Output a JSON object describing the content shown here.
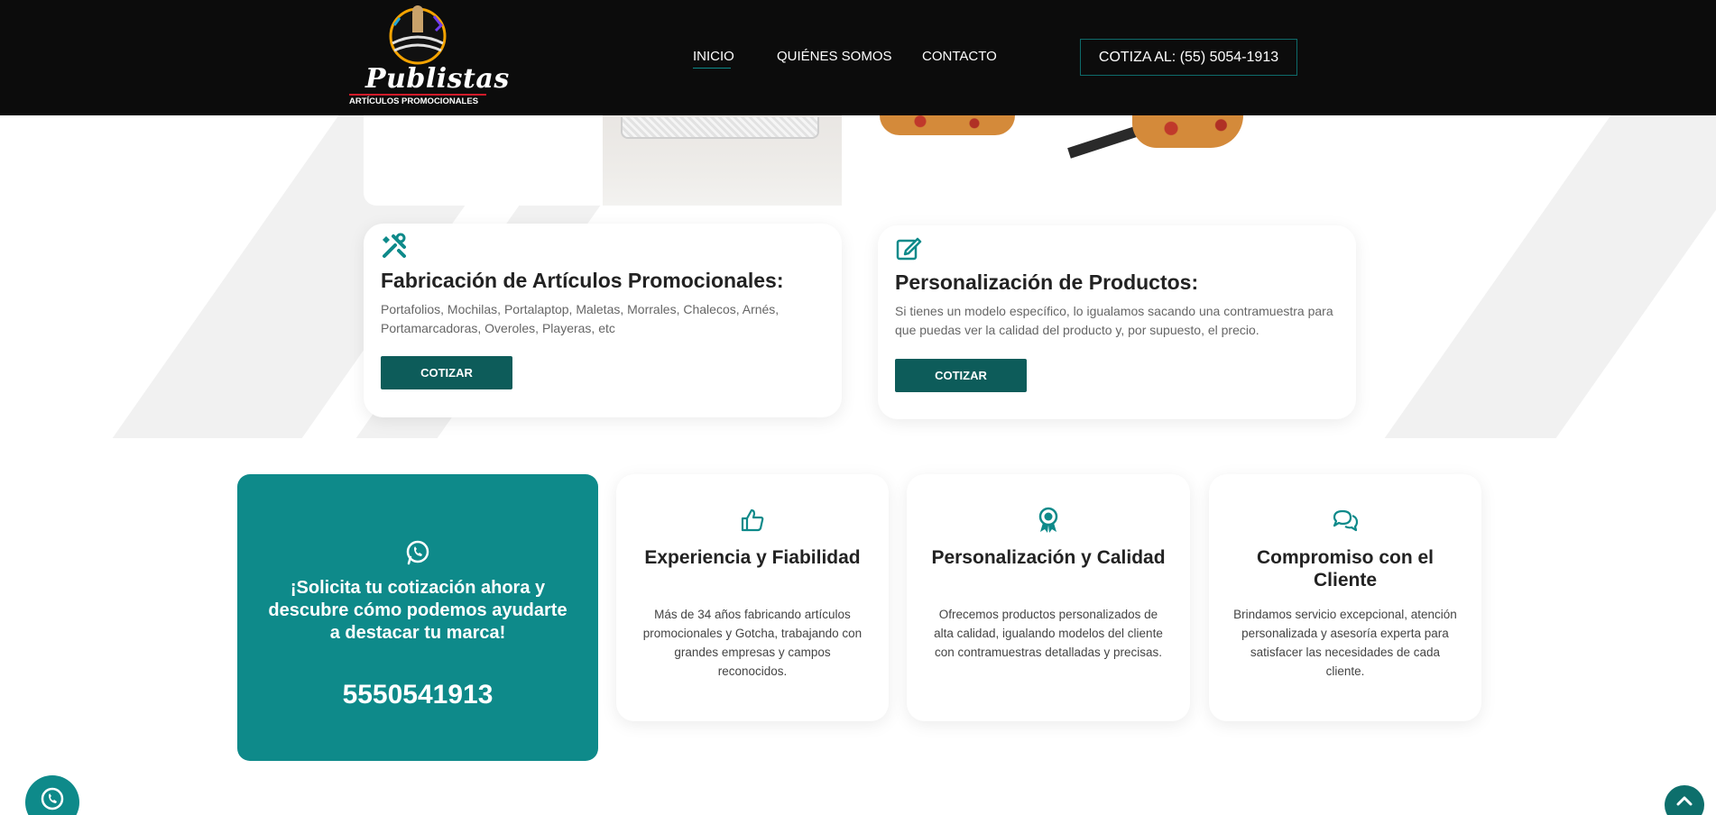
{
  "header": {
    "logo": {
      "brand": "Publistas",
      "tagline": "ARTÍCULOS PROMOCIONALES"
    },
    "nav": [
      {
        "label": "INICIO",
        "active": true
      },
      {
        "label": "QUIÉNES SOMOS",
        "active": false
      },
      {
        "label": "CONTACTO",
        "active": false
      }
    ],
    "cta_label": "COTIZA AL: (55) 5054-1913"
  },
  "services": [
    {
      "icon": "tools-icon",
      "title": "Fabricación de Artículos Promocionales:",
      "text": "Portafolios, Mochilas, Portalaptop, Maletas, Morrales, Chalecos, Arnés, Portamarcadoras, Overoles, Playeras, etc",
      "button": "COTIZAR"
    },
    {
      "icon": "edit-icon",
      "title": "Personalización de Productos:",
      "text": "Si tienes un modelo específico, lo igualamos sacando una contramuestra para que puedas ver la calidad del producto y, por supuesto, el precio.",
      "button": "COTIZAR"
    }
  ],
  "promo": {
    "icon": "whatsapp-icon",
    "text": "¡Solicita tu cotización ahora y descubre cómo podemos ayudarte a destacar tu marca!",
    "phone": "5550541913"
  },
  "features": [
    {
      "icon": "thumbs-up-icon",
      "title": "Experiencia y Fiabilidad",
      "text": "Más de 34 años fabricando artículos promocionales y Gotcha, trabajando con grandes empresas y campos reconocidos."
    },
    {
      "icon": "award-icon",
      "title": "Personalización y Calidad",
      "text": "Ofrecemos productos personalizados de alta calidad, igualando modelos del cliente con contramuestras detalladas y precisas."
    },
    {
      "icon": "comments-icon",
      "title": "Compromiso con el Cliente",
      "text": "Brindamos servicio excepcional, atención personalizada y asesoría experta para satisfacer las necesidades  de cada cliente."
    }
  ],
  "colors": {
    "header_bg": "#0c0c0c",
    "accent": "#0e8a8a",
    "button_bg": "#0d5c5a"
  }
}
